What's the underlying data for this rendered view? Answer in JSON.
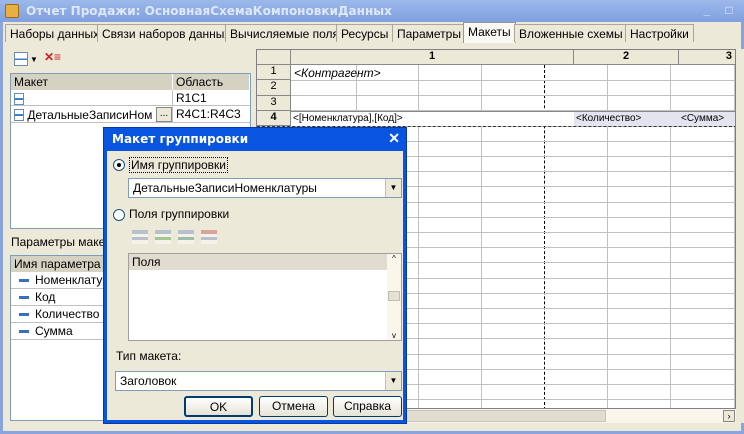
{
  "window": {
    "title": "Отчет Продажи: ОсновнаяСхемаКомпоновкиДанных",
    "minimize": "_",
    "maximize": "□"
  },
  "tabs": [
    {
      "label": "Наборы данных"
    },
    {
      "label": "Связи наборов данных"
    },
    {
      "label": "Вычисляемые поля"
    },
    {
      "label": "Ресурсы"
    },
    {
      "label": "Параметры"
    },
    {
      "label": "Макеты",
      "active": true
    },
    {
      "label": "Вложенные схемы"
    },
    {
      "label": "Настройки"
    }
  ],
  "layouts": {
    "headers": [
      "Макет",
      "Область"
    ],
    "rows": [
      {
        "name": "",
        "area": "R1C1"
      },
      {
        "name": "ДетальныеЗаписиНоменклатуры",
        "area": "R4C1:R4C3",
        "ellipsis": "..."
      }
    ]
  },
  "params": {
    "label": "Параметры макета",
    "header": "Имя параметра",
    "rows": [
      "Номенклатура",
      "Код",
      "Количество",
      "Сумма"
    ]
  },
  "grid": {
    "col_headers": [
      "1",
      "2",
      "3"
    ],
    "row_headers": [
      "1",
      "2",
      "3",
      "4"
    ],
    "cells": {
      "r1": "<Контрагент>",
      "r4c1": "<[Номенклатура],[Код]>",
      "r4c2": "<Количество>",
      "r4c3": "<Сумма>"
    }
  },
  "dialog": {
    "title": "Макет группировки",
    "close": "✕",
    "radio_name": "Имя группировки",
    "name_value": "ДетальныеЗаписиНоменклатуры",
    "radio_fields": "Поля группировки",
    "fields_header": "Поля",
    "type_label": "Тип макета:",
    "type_value": "Заголовок",
    "ok": "OK",
    "cancel": "Отмена",
    "help": "Справка"
  }
}
